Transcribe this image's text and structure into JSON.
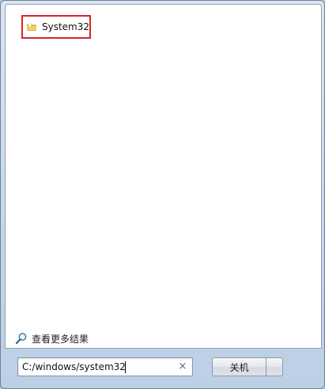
{
  "results": {
    "items": [
      {
        "label": "System32",
        "icon": "folder-icon"
      }
    ]
  },
  "see_more": {
    "label": "查看更多结果",
    "icon": "magnifier-icon"
  },
  "search": {
    "value": "C:/windows/system32",
    "clear_icon": "clear-icon",
    "clear_glyph": "×"
  },
  "shutdown": {
    "label": "关机"
  },
  "colors": {
    "highlight_border": "#d9232a",
    "frame_background": "#c6d6e9",
    "pane_background": "#ffffff"
  }
}
